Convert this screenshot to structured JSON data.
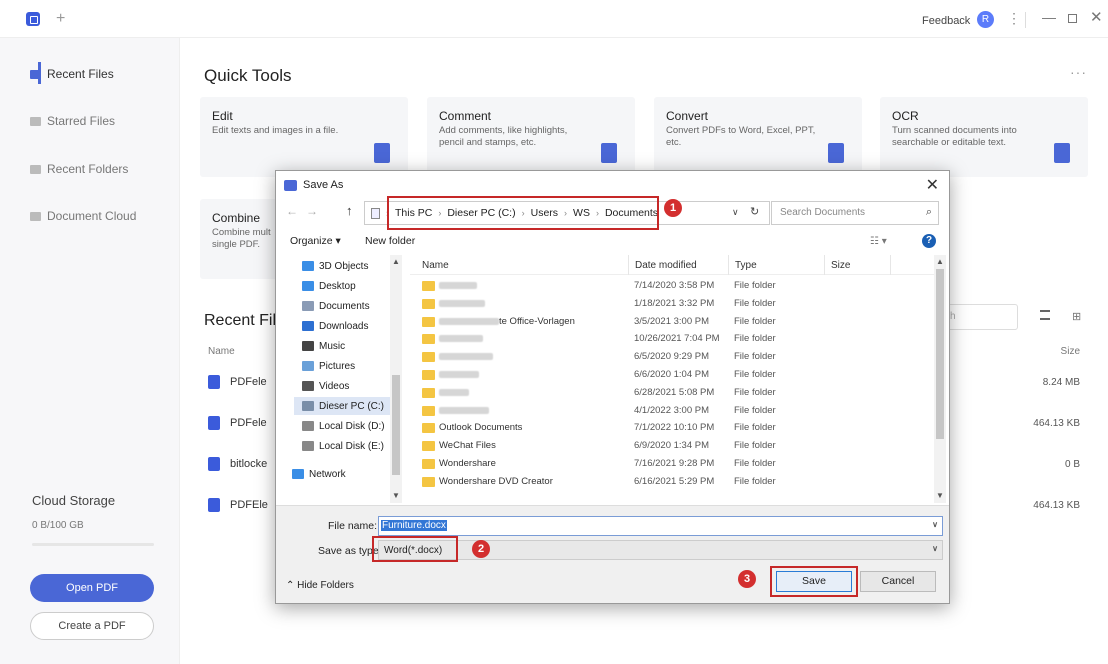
{
  "app": {
    "feedback_label": "Feedback",
    "avatar_letter": "R",
    "plus_glyph": "+",
    "accent_color": "#4a67d6"
  },
  "sidebar": {
    "items": [
      {
        "label": "Recent Files",
        "icon": "recent-files-icon",
        "active": true
      },
      {
        "label": "Starred Files",
        "icon": "star-icon",
        "active": false
      },
      {
        "label": "Recent Folders",
        "icon": "folder-icon",
        "active": false
      },
      {
        "label": "Document Cloud",
        "icon": "cloud-icon",
        "active": false
      }
    ],
    "cloud_storage_label": "Cloud Storage",
    "cloud_storage_usage": "0 B/100 GB",
    "open_pdf_label": "Open PDF",
    "create_pdf_label": "Create a PDF"
  },
  "main": {
    "quick_tools_title": "Quick Tools",
    "tools": [
      {
        "title": "Edit",
        "desc": "Edit texts and images in a file."
      },
      {
        "title": "Comment",
        "desc": "Add comments, like highlights, pencil and stamps, etc."
      },
      {
        "title": "Convert",
        "desc": "Convert PDFs to Word, Excel, PPT, etc."
      },
      {
        "title": "OCR",
        "desc": "Turn scanned documents into searchable or editable text."
      },
      {
        "title": "Combine",
        "desc": "Combine mult single PDF."
      }
    ],
    "recent_files_title": "Recent Fil",
    "search_placeholder": "ch",
    "col_name": "Name",
    "col_size": "Size",
    "files": [
      {
        "name": "PDFele",
        "size": "8.24 MB"
      },
      {
        "name": "PDFele",
        "size": "464.13 KB"
      },
      {
        "name": "bitlocke",
        "size": "0 B"
      },
      {
        "name": "PDFEle",
        "size": "464.13 KB"
      }
    ]
  },
  "dialog": {
    "title": "Save As",
    "address": {
      "segments": [
        "This PC",
        "Dieser PC (C:)",
        "Users",
        "WS",
        "Documents"
      ],
      "separator": "›"
    },
    "search_placeholder": "Search Documents",
    "organize_label": "Organize ▾",
    "new_folder_label": "New folder",
    "nav_items": [
      {
        "label": "3D Objects",
        "color": "#3a8ee6"
      },
      {
        "label": "Desktop",
        "color": "#3a8ee6"
      },
      {
        "label": "Documents",
        "color": "#8a9bb5"
      },
      {
        "label": "Downloads",
        "color": "#2d6fd1"
      },
      {
        "label": "Music",
        "color": "#444"
      },
      {
        "label": "Pictures",
        "color": "#6aa0d8"
      },
      {
        "label": "Videos",
        "color": "#555"
      },
      {
        "label": "Dieser PC (C:)",
        "color": "#7a8ea8",
        "selected": true
      },
      {
        "label": "Local Disk (D:)",
        "color": "#888"
      },
      {
        "label": "Local Disk (E:)",
        "color": "#888"
      },
      {
        "label": "Network",
        "color": "#3a8ee6"
      }
    ],
    "columns": {
      "name": "Name",
      "date": "Date modified",
      "type": "Type",
      "size": "Size"
    },
    "rows": [
      {
        "name": "",
        "blur_w": 38,
        "date": "7/14/2020 3:58 PM",
        "type": "File folder"
      },
      {
        "name": "",
        "blur_w": 46,
        "date": "1/18/2021 3:32 PM",
        "type": "File folder"
      },
      {
        "name": "te Office-Vorlagen",
        "blur_w": 60,
        "date": "3/5/2021 3:00 PM",
        "type": "File folder"
      },
      {
        "name": "",
        "blur_w": 44,
        "date": "10/26/2021 7:04 PM",
        "type": "File folder"
      },
      {
        "name": "",
        "blur_w": 54,
        "date": "6/5/2020 9:29 PM",
        "type": "File folder"
      },
      {
        "name": "",
        "blur_w": 40,
        "date": "6/6/2020 1:04 PM",
        "type": "File folder"
      },
      {
        "name": "",
        "blur_w": 30,
        "date": "6/28/2021 5:08 PM",
        "type": "File folder"
      },
      {
        "name": "",
        "blur_w": 50,
        "date": "4/1/2022 3:00 PM",
        "type": "File folder"
      },
      {
        "name": "Outlook Documents",
        "blur_w": 0,
        "date": "7/1/2022 10:10 PM",
        "type": "File folder"
      },
      {
        "name": "WeChat Files",
        "blur_w": 0,
        "date": "6/9/2020 1:34 PM",
        "type": "File folder"
      },
      {
        "name": "Wondershare",
        "blur_w": 0,
        "date": "7/16/2021 9:28 PM",
        "type": "File folder"
      },
      {
        "name": "Wondershare DVD Creator",
        "blur_w": 0,
        "date": "6/16/2021 5:29 PM",
        "type": "File folder"
      }
    ],
    "file_name_label": "File name:",
    "file_name_value": "Furniture.docx",
    "save_type_label": "Save as type:",
    "save_type_value": "Word(*.docx)",
    "hide_folders_label": "Hide Folders",
    "save_label": "Save",
    "cancel_label": "Cancel",
    "badges": [
      "1",
      "2",
      "3"
    ],
    "highlight_color": "#c62828"
  }
}
